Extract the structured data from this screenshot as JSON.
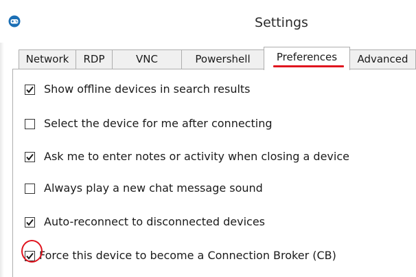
{
  "window": {
    "title": "Settings",
    "app_icon": "gamepad-icon"
  },
  "tabs": [
    {
      "label": "Network",
      "active": false
    },
    {
      "label": "RDP",
      "active": false
    },
    {
      "label": "VNC",
      "active": false
    },
    {
      "label": "Powershell",
      "active": false
    },
    {
      "label": "Preferences",
      "active": true
    },
    {
      "label": "Advanced",
      "active": false
    }
  ],
  "preferences": {
    "options": [
      {
        "label": "Show offline devices in search results",
        "checked": true
      },
      {
        "label": "Select the device for me after connecting",
        "checked": false
      },
      {
        "label": "Ask me to enter notes or activity when closing a device",
        "checked": true
      },
      {
        "label": "Always play a new chat message sound",
        "checked": false
      },
      {
        "label": "Auto-reconnect to disconnected devices",
        "checked": true
      },
      {
        "label": "Force this device to become a Connection Broker (CB)",
        "checked": true
      }
    ]
  },
  "colors": {
    "accent_annotation": "#e0141e",
    "app_icon_blue": "#1b6fb5"
  }
}
